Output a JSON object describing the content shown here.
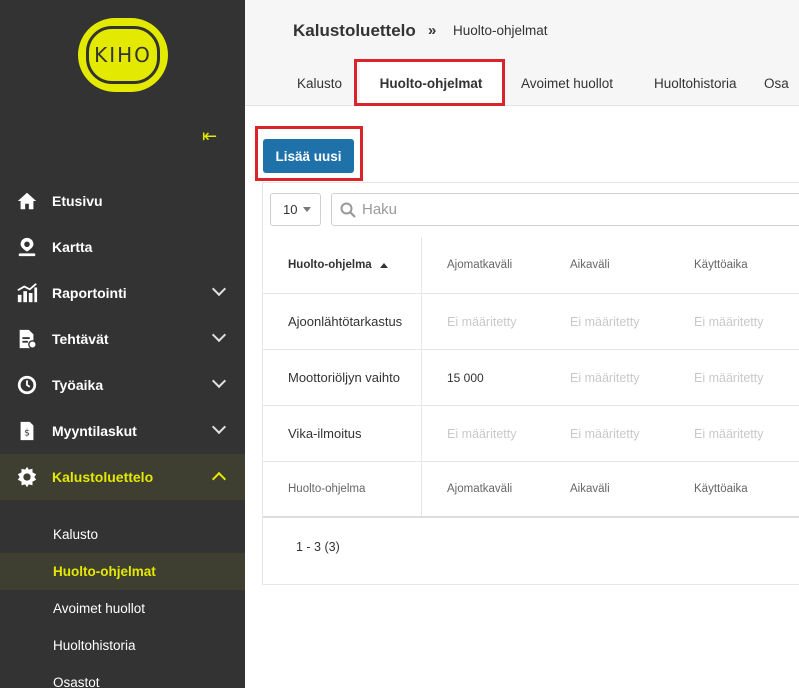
{
  "brand": {
    "logo_text": "KIHO",
    "accent": "#e4e900",
    "sidebar_bg": "#333333"
  },
  "sidebar": {
    "collapse_icon": "collapse-left-arrow",
    "items": [
      {
        "label": "Etusivu",
        "icon": "home-icon"
      },
      {
        "label": "Kartta",
        "icon": "map-pin-icon"
      },
      {
        "label": "Raportointi",
        "icon": "chart-bars-icon"
      },
      {
        "label": "Tehtävät",
        "icon": "task-document-icon"
      },
      {
        "label": "Työaika",
        "icon": "clock-icon"
      },
      {
        "label": "Myyntilaskut",
        "icon": "invoice-icon"
      },
      {
        "label": "Kalustoluettelo",
        "icon": "gear-icon"
      }
    ],
    "subitems": [
      {
        "label": "Kalusto"
      },
      {
        "label": "Huolto-ohjelmat"
      },
      {
        "label": "Avoimet huollot"
      },
      {
        "label": "Huoltohistoria"
      },
      {
        "label": "Osastot"
      }
    ]
  },
  "header": {
    "title": "Kalustoluettelo",
    "separator": "»",
    "subtitle": "Huolto-ohjelmat",
    "tabs": [
      {
        "label": "Kalusto"
      },
      {
        "label": "Huolto-ohjelmat"
      },
      {
        "label": "Avoimet huollot"
      },
      {
        "label": "Huoltohistoria"
      },
      {
        "label": "Osa"
      }
    ]
  },
  "toolbar": {
    "add_label": "Lisää uusi",
    "accent": "#1e71a9"
  },
  "list": {
    "page_size": "10",
    "search_placeholder": "Haku",
    "columns": [
      "Huolto-ohjelma",
      "Ajomatkaväli",
      "Aikaväli",
      "Käyttöaika"
    ],
    "rows": [
      [
        "Ajoonlähtötarkastus",
        "Ei määritetty",
        "Ei määritetty",
        "Ei määritetty"
      ],
      [
        "Moottoriöljyn vaihto",
        "15 000",
        "Ei määritetty",
        "Ei määritetty"
      ],
      [
        "Vika-ilmoitus",
        "Ei määritetty",
        "Ei määritetty",
        "Ei määritetty"
      ]
    ],
    "pagination": "1 - 3 (3)"
  },
  "highlight_color": "#d9242b"
}
